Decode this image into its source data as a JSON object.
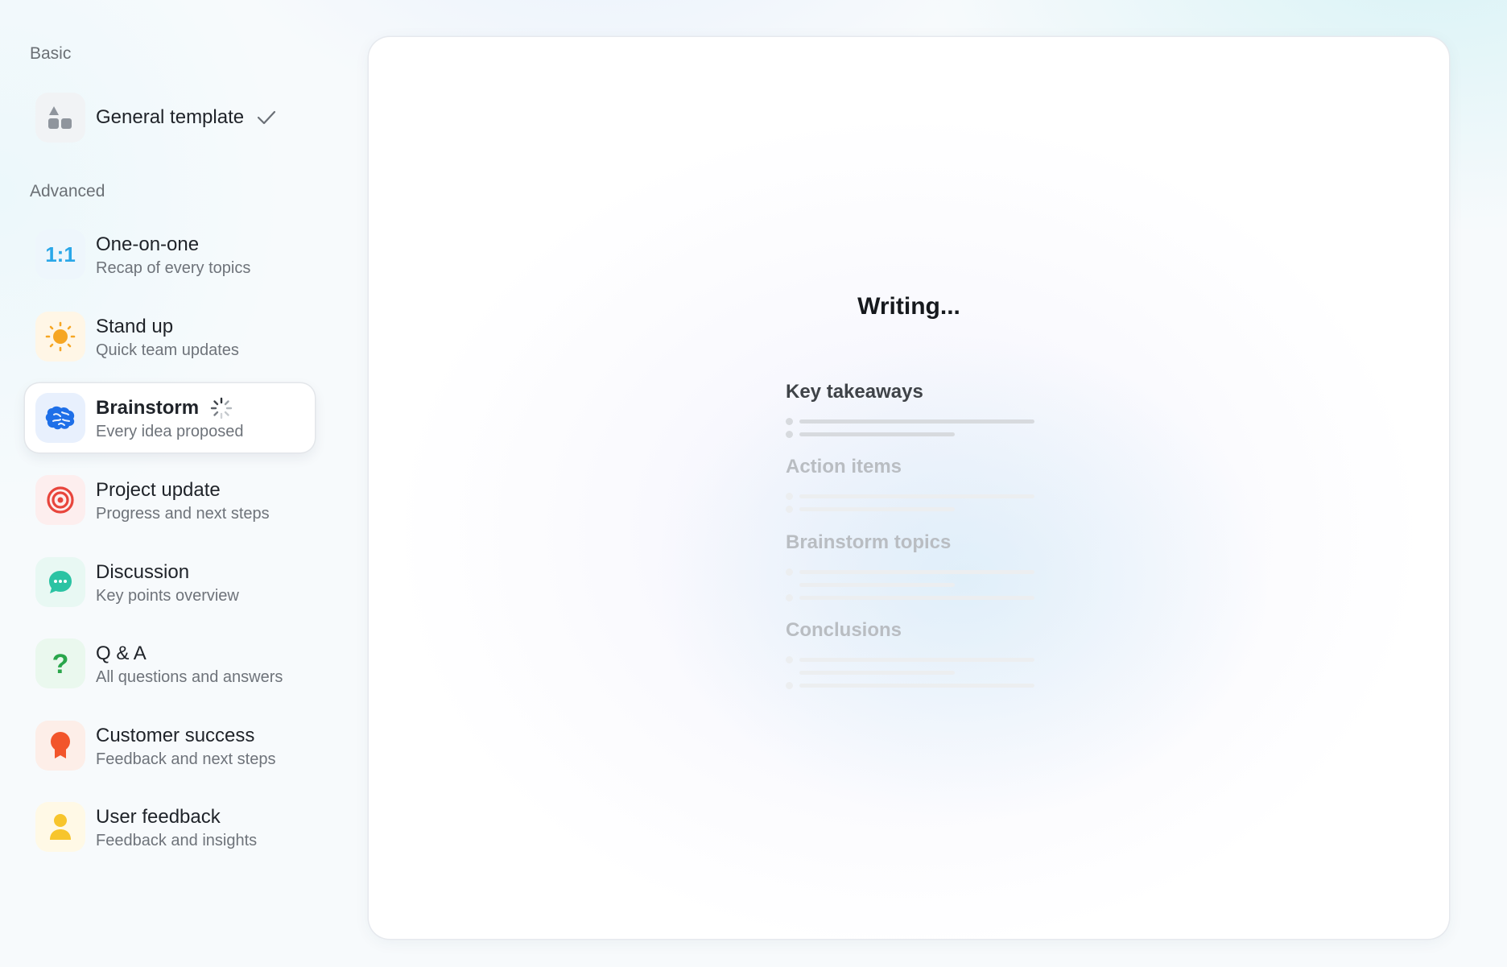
{
  "sidebar": {
    "basic_label": "Basic",
    "advanced_label": "Advanced",
    "general": {
      "title": "General template",
      "selected_check": "check-icon"
    },
    "items": [
      {
        "title": "One-on-one",
        "subtitle": "Recap of every topics",
        "icon": "one-on-one-icon"
      },
      {
        "title": "Stand up",
        "subtitle": "Quick team updates",
        "icon": "sun-icon"
      },
      {
        "title": "Brainstorm",
        "subtitle": "Every idea proposed",
        "icon": "brain-icon",
        "state": "loading"
      },
      {
        "title": "Project update",
        "subtitle": "Progress and next steps",
        "icon": "target-icon"
      },
      {
        "title": "Discussion",
        "subtitle": "Key points overview",
        "icon": "chat-bubble-icon"
      },
      {
        "title": "Q & A",
        "subtitle": "All questions and answers",
        "icon": "question-mark-icon"
      },
      {
        "title": "Customer success",
        "subtitle": "Feedback and next steps",
        "icon": "award-ribbon-icon"
      },
      {
        "title": "User feedback",
        "subtitle": "Feedback and insights",
        "icon": "user-icon"
      }
    ]
  },
  "panel": {
    "status": "Writing...",
    "sections": [
      {
        "title": "Key takeaways"
      },
      {
        "title": "Action items"
      },
      {
        "title": "Brainstorm topics"
      },
      {
        "title": "Conclusions"
      }
    ]
  },
  "colors": {
    "one_on_one": "#2aa7e8",
    "sun": "#f6a623",
    "brain": "#1e6fe8",
    "target": "#e8453c",
    "chat": "#2bc3a3",
    "question": "#2aa64b",
    "award": "#f2552b",
    "user": "#f7c52c"
  }
}
